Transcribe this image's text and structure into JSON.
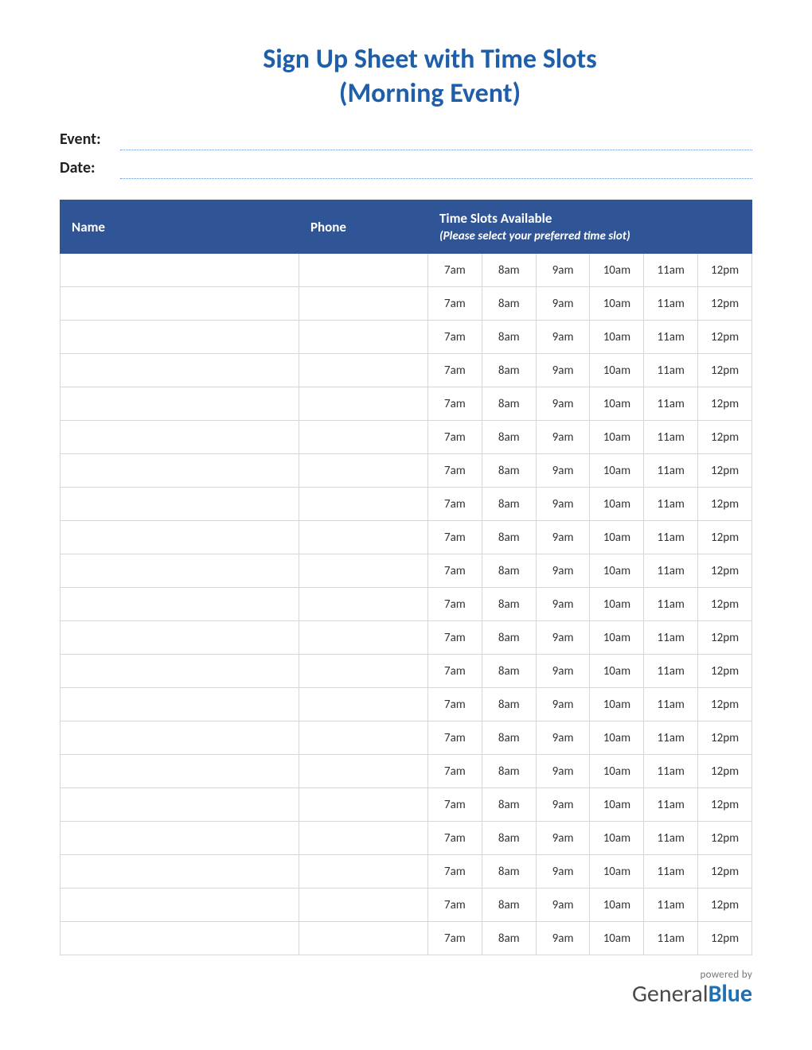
{
  "title_line1": "Sign Up Sheet with Time Slots",
  "title_line2": "(Morning Event)",
  "meta": {
    "event_label": "Event:",
    "event_value": "",
    "date_label": "Date:",
    "date_value": ""
  },
  "table": {
    "header": {
      "name": "Name",
      "phone": "Phone",
      "slots_title": "Time Slots Available",
      "slots_subtitle": "(Please select your preferred time slot)"
    },
    "time_slots": [
      "7am",
      "8am",
      "9am",
      "10am",
      "11am",
      "12pm"
    ],
    "row_count": 21
  },
  "footer": {
    "powered": "powered by",
    "brand_part1": "General",
    "brand_part2": "Blue"
  },
  "colors": {
    "header_bg": "#2f5597",
    "accent": "#1f5faa",
    "border": "#d6d6d6"
  }
}
